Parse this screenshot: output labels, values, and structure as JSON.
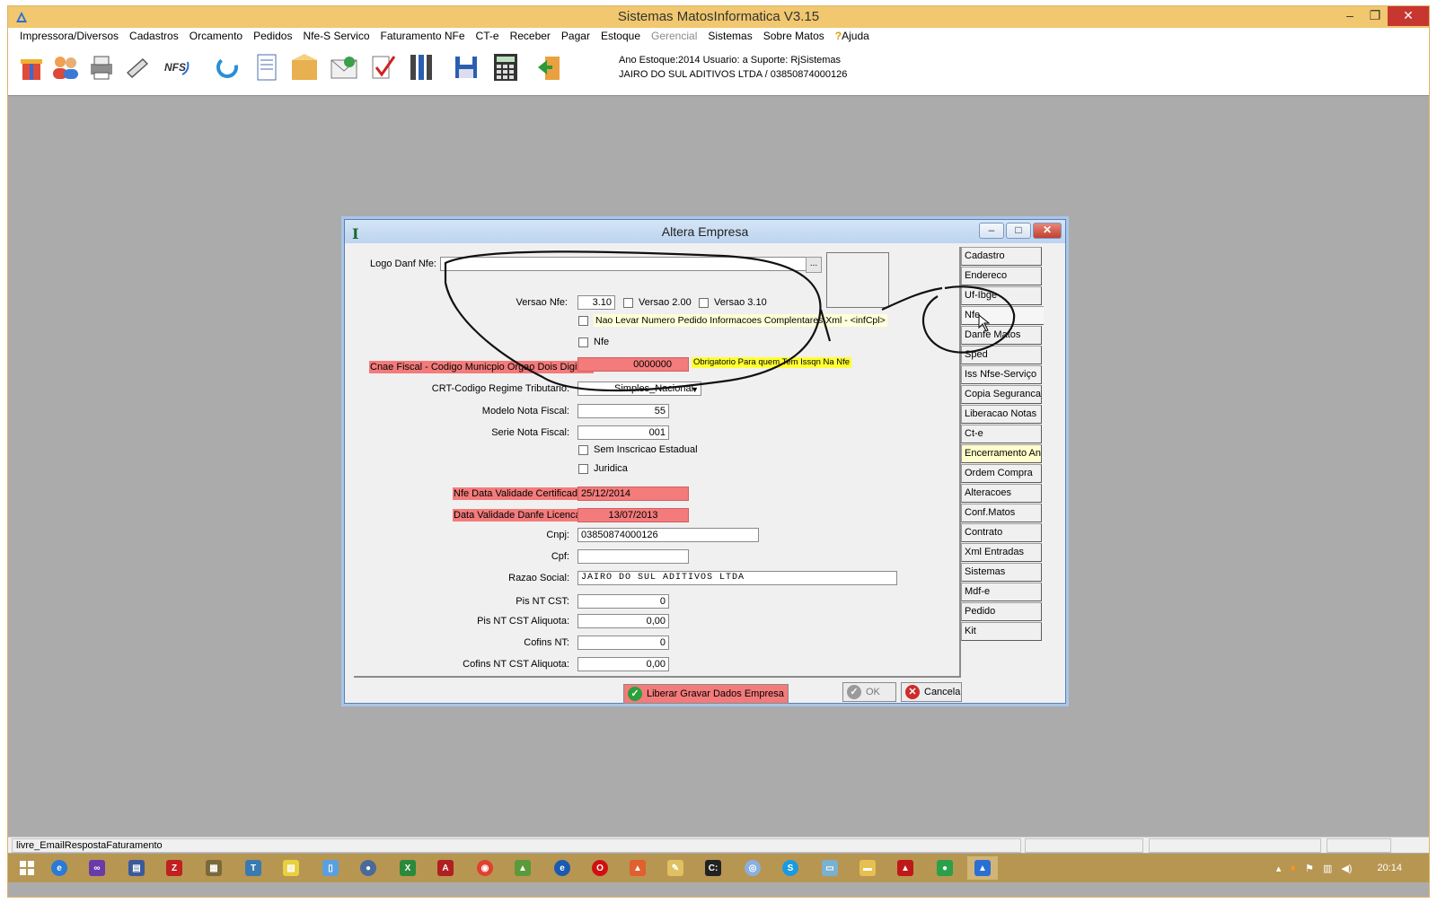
{
  "app": {
    "title": "Sistemas MatosInformatica V3.15",
    "info_line1": "Ano Estoque:2014 Usuario: a Suporte: RjSistemas",
    "info_line2": "JAIRO DO SUL ADITIVOS LTDA / 03850874000126"
  },
  "menu": [
    {
      "label": "Impressora/Diversos"
    },
    {
      "label": "Cadastros"
    },
    {
      "label": "Orcamento"
    },
    {
      "label": "Pedidos"
    },
    {
      "label": "Nfe-S Servico"
    },
    {
      "label": "Faturamento NFe"
    },
    {
      "label": "CT-e"
    },
    {
      "label": "Receber"
    },
    {
      "label": "Pagar"
    },
    {
      "label": "Estoque"
    },
    {
      "label": "Gerencial"
    },
    {
      "label": "Sistemas"
    },
    {
      "label": "Sobre Matos"
    },
    {
      "label": "Ajuda"
    }
  ],
  "toolbar_icons": [
    "gift-icon",
    "users-icon",
    "printer-icon",
    "scanner-icon",
    "nfs-icon",
    "refresh-icon",
    "report-icon",
    "box-icon",
    "mail-icon",
    "check-icon",
    "tools-icon",
    "save-icon",
    "calculator-icon",
    "exit-icon"
  ],
  "dialog": {
    "title": "Altera Empresa",
    "logo_label": "Logo Danf Nfe:",
    "browse_label": "...",
    "versao_label": "Versao Nfe:",
    "versao_value": "3.10",
    "versao_200": "Versao 2.00",
    "versao_310": "Versao 3.10",
    "nao_levar": "Nao Levar Numero Pedido Informacoes Complentares Xml - <infCpl>",
    "nfe_check": "Nfe",
    "cnae_label": "Cnae Fiscal - Codigo Municpio Orgao Dois Digitos:",
    "cnae_value": "0000000",
    "cnae_note": "Obrigatorio Para quem Tem Issqn Na Nfe",
    "crt_label": "CRT-Codigo Regime Tributario:",
    "crt_value": "Simples_Nacional",
    "modelo_label": "Modelo Nota Fiscal:",
    "modelo_value": "55",
    "serie_label": "Serie Nota Fiscal:",
    "serie_value": "001",
    "sem_inscricao": "Sem Inscricao Estadual",
    "juridica": "Juridica",
    "cert_label": "Nfe Data Validade Certificado:",
    "cert_value": "25/12/2014",
    "danfe_label": "Data Validade Danfe Licenca:",
    "danfe_value": "13/07/2013",
    "cnpj_label": "Cnpj:",
    "cnpj_value": "03850874000126",
    "cpf_label": "Cpf:",
    "cpf_value": "",
    "razao_label": "Razao Social:",
    "razao_value": "JAIRO DO SUL ADITIVOS LTDA",
    "pis_label": "Pis NT CST:",
    "pis_value": "0",
    "pis_aliq_label": "Pis NT CST Aliquota:",
    "pis_aliq_value": "0,00",
    "cofins_label": "Cofins NT:",
    "cofins_value": "0",
    "cofins_aliq_label": "Cofins NT CST Aliquota:",
    "cofins_aliq_value": "0,00",
    "liberar_label": "Liberar Gravar Dados Empresa",
    "ok_label": "OK",
    "cancel_label": "Cancela"
  },
  "side_tabs": [
    {
      "label": "Cadastro"
    },
    {
      "label": "Endereco"
    },
    {
      "label": "Uf-Ibge"
    },
    {
      "label": "Nfe"
    },
    {
      "label": "Danfe Matos"
    },
    {
      "label": "Sped"
    },
    {
      "label": "Iss Nfse-Serviço"
    },
    {
      "label": "Copia Seguranca"
    },
    {
      "label": "Liberacao Notas"
    },
    {
      "label": "Ct-e"
    },
    {
      "label": "Encerramento Ano"
    },
    {
      "label": "Ordem Compra"
    },
    {
      "label": "Alteracoes"
    },
    {
      "label": "Conf.Matos"
    },
    {
      "label": "Contrato"
    },
    {
      "label": "Xml Entradas"
    },
    {
      "label": "Sistemas"
    },
    {
      "label": "Mdf-e"
    },
    {
      "label": "Pedido"
    },
    {
      "label": "Kit"
    }
  ],
  "status": {
    "text": "livre_EmailRespostaFaturamento"
  },
  "taskbar": {
    "clock": "20:14"
  },
  "colors": {
    "titlebar": "#f1c76f",
    "required_field": "#f37b7b",
    "note_yellow": "#ffff33",
    "taskbar": "#b79652"
  }
}
